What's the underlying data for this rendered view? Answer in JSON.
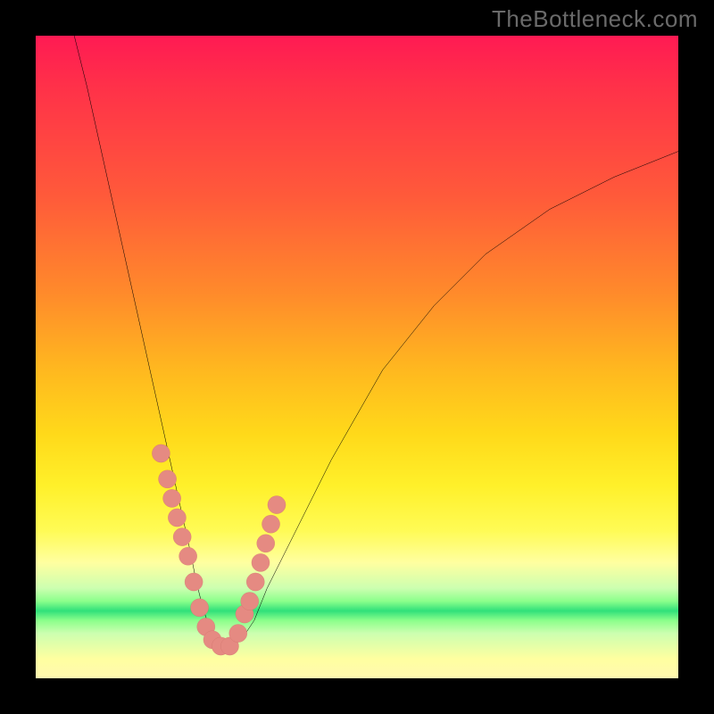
{
  "watermark": "TheBottleneck.com",
  "colors": {
    "page_bg": "#000000",
    "gradient_top": "#ff1a53",
    "gradient_mid": "#ffd91a",
    "gradient_green": "#30e07a",
    "curve_stroke": "#000000",
    "marker_fill": "#e58a82",
    "marker_stroke": "#c96b63"
  },
  "chart_data": {
    "type": "line",
    "title": "",
    "xlabel": "",
    "ylabel": "",
    "xlim": [
      0,
      100
    ],
    "ylim": [
      0,
      100
    ],
    "grid": false,
    "legend": false,
    "series": [
      {
        "name": "bottleneck-curve",
        "x": [
          6,
          8,
          10,
          12,
          14,
          16,
          18,
          20,
          22,
          24,
          25,
          26,
          27,
          28,
          29,
          30,
          32,
          34,
          36,
          40,
          46,
          54,
          62,
          70,
          80,
          90,
          100
        ],
        "y": [
          100,
          92,
          83,
          74,
          65,
          56,
          47,
          38,
          29,
          20,
          15,
          11,
          8,
          6,
          5,
          5,
          6,
          9,
          14,
          22,
          34,
          48,
          58,
          66,
          73,
          78,
          82
        ]
      }
    ],
    "markers": {
      "name": "highlight-dots",
      "x": [
        19.5,
        20.5,
        21.2,
        22.0,
        22.8,
        23.7,
        24.6,
        25.5,
        26.5,
        27.5,
        28.8,
        30.2,
        31.5,
        32.5,
        33.3,
        34.2,
        35.0,
        35.8,
        36.6,
        37.5
      ],
      "y": [
        35,
        31,
        28,
        25,
        22,
        19,
        15,
        11,
        8,
        6,
        5,
        5,
        7,
        10,
        12,
        15,
        18,
        21,
        24,
        27
      ]
    }
  }
}
